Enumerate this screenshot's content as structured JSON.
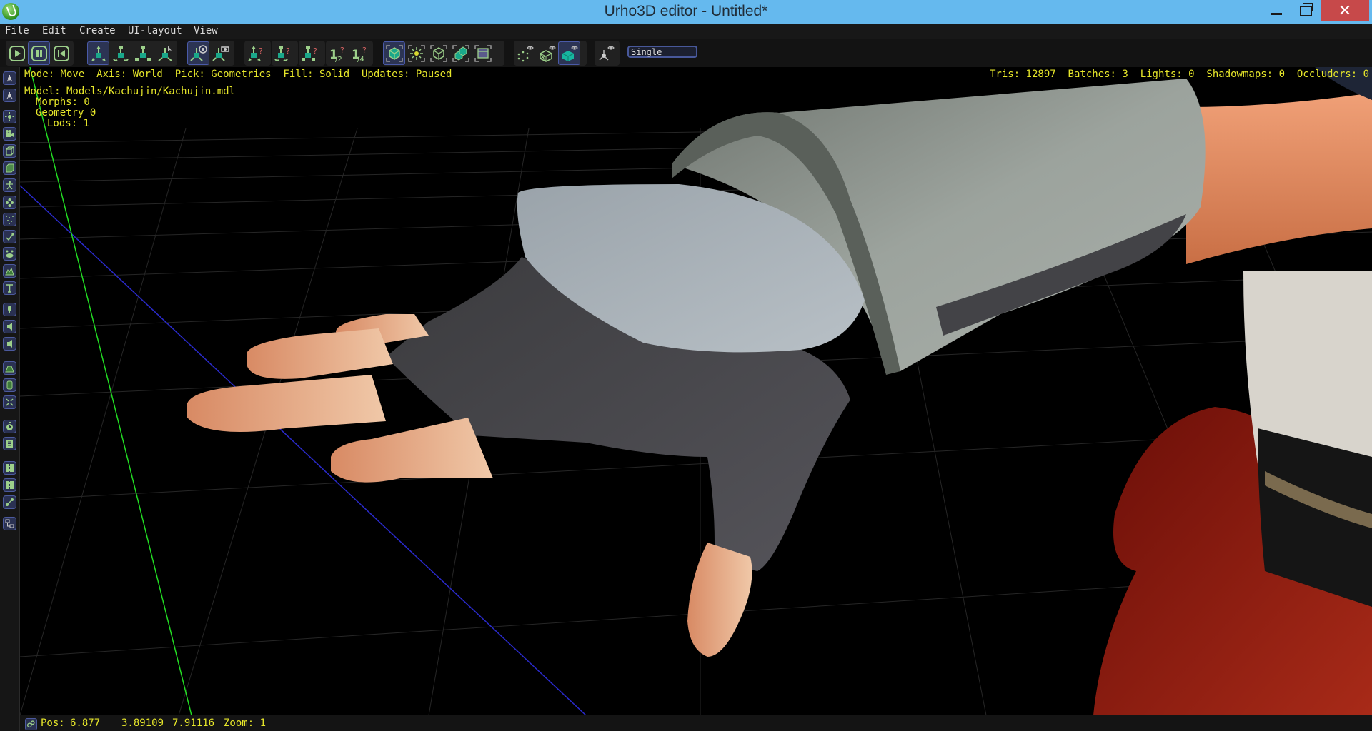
{
  "window": {
    "title": "Urho3D editor - Untitled*",
    "controls": {
      "minimize": "minimize",
      "maximize": "restore",
      "close": "✕"
    }
  },
  "menubar": {
    "items": [
      {
        "label": "File"
      },
      {
        "label": "Edit"
      },
      {
        "label": "Create"
      },
      {
        "label": "UI-layout"
      },
      {
        "label": "View"
      }
    ]
  },
  "toolbar": {
    "groups": [
      {
        "name": "playback",
        "buttons": [
          {
            "icon": "play-icon",
            "active": false
          },
          {
            "icon": "pause-icon",
            "active": true
          },
          {
            "icon": "rewind-icon",
            "active": false
          }
        ]
      },
      {
        "name": "edit-mode",
        "buttons": [
          {
            "icon": "move-gizmo-icon",
            "active": true
          },
          {
            "icon": "rotate-gizmo-icon",
            "active": false
          },
          {
            "icon": "scale-gizmo-icon",
            "active": false
          },
          {
            "icon": "select-gizmo-icon",
            "active": false
          }
        ]
      },
      {
        "name": "axis-mode",
        "buttons": [
          {
            "icon": "world-axis-icon",
            "active": true
          },
          {
            "icon": "local-axis-icon",
            "active": false
          }
        ]
      },
      {
        "name": "snap",
        "buttons": [
          {
            "icon": "move-snap-icon",
            "active": false
          },
          {
            "icon": "rotate-snap-icon",
            "active": false
          },
          {
            "icon": "scale-snap-icon",
            "active": false
          },
          {
            "icon": "snap-half-icon",
            "active": false,
            "text": "½"
          },
          {
            "icon": "snap-quarter-icon",
            "active": false,
            "text": "¼"
          }
        ]
      },
      {
        "name": "pick-mode",
        "buttons": [
          {
            "icon": "pick-geometries-icon",
            "active": true
          },
          {
            "icon": "pick-lights-icon",
            "active": false
          },
          {
            "icon": "pick-zones-icon",
            "active": false
          },
          {
            "icon": "pick-rigidbodies-icon",
            "active": false
          },
          {
            "icon": "pick-ui-elements-icon",
            "active": false
          }
        ]
      },
      {
        "name": "fill-mode",
        "buttons": [
          {
            "icon": "fill-points-icon",
            "active": false
          },
          {
            "icon": "fill-wireframe-icon",
            "active": false
          },
          {
            "icon": "fill-solid-icon",
            "active": true
          }
        ]
      },
      {
        "name": "view",
        "buttons": [
          {
            "icon": "toggle-grid-icon",
            "active": false
          }
        ]
      }
    ],
    "view_mode": {
      "value": "Single"
    }
  },
  "sidebar": {
    "items": [
      {
        "icon": "node-icon"
      },
      {
        "icon": "node-local-icon"
      },
      {
        "icon": "light-icon"
      },
      {
        "icon": "camera-icon"
      },
      {
        "icon": "box-model-icon"
      },
      {
        "icon": "animated-model-icon"
      },
      {
        "icon": "skeleton-figure-icon"
      },
      {
        "icon": "billboard-icon"
      },
      {
        "icon": "particle-emitter-icon"
      },
      {
        "icon": "custom-geometry-icon"
      },
      {
        "icon": "decal-icon"
      },
      {
        "icon": "terrain-icon"
      },
      {
        "icon": "text3d-icon"
      },
      {
        "icon": "sound-listener-icon"
      },
      {
        "icon": "sound-source-icon"
      },
      {
        "icon": "sound-source-3d-icon"
      },
      {
        "icon": "rigid-body-icon"
      },
      {
        "icon": "collision-shape-icon"
      },
      {
        "icon": "constraint-icon"
      },
      {
        "icon": "animation-controller-icon"
      },
      {
        "icon": "script-icon"
      },
      {
        "icon": "navigation-mesh-icon"
      },
      {
        "icon": "navigable-icon"
      },
      {
        "icon": "offmesh-connection-icon"
      },
      {
        "icon": "network-icon"
      }
    ]
  },
  "viewport": {
    "info": "Mode: Move  Axis: World  Pick: Geometries  Fill: Solid  Updates: Paused",
    "stats": "Tris: 12897  Batches: 3  Lights: 0  Shadowmaps: 0  Occluders: 0",
    "model": {
      "path": "Model: Models/Kachujin/Kachujin.mdl",
      "morphs": "Morphs: 0",
      "geometry": "Geometry 0",
      "lods": "Lods: 1"
    },
    "colors": {
      "overlay_text": "#e6e62a",
      "y_axis": "#22dd22",
      "z_axis": "#2a2acc",
      "grid": "#2a2a2a"
    }
  },
  "statusbar": {
    "pos_label": "Pos:",
    "pos_x": "6.877",
    "pos_y": "3.89109",
    "pos_z": "7.91116",
    "zoom": "Zoom: 1"
  }
}
